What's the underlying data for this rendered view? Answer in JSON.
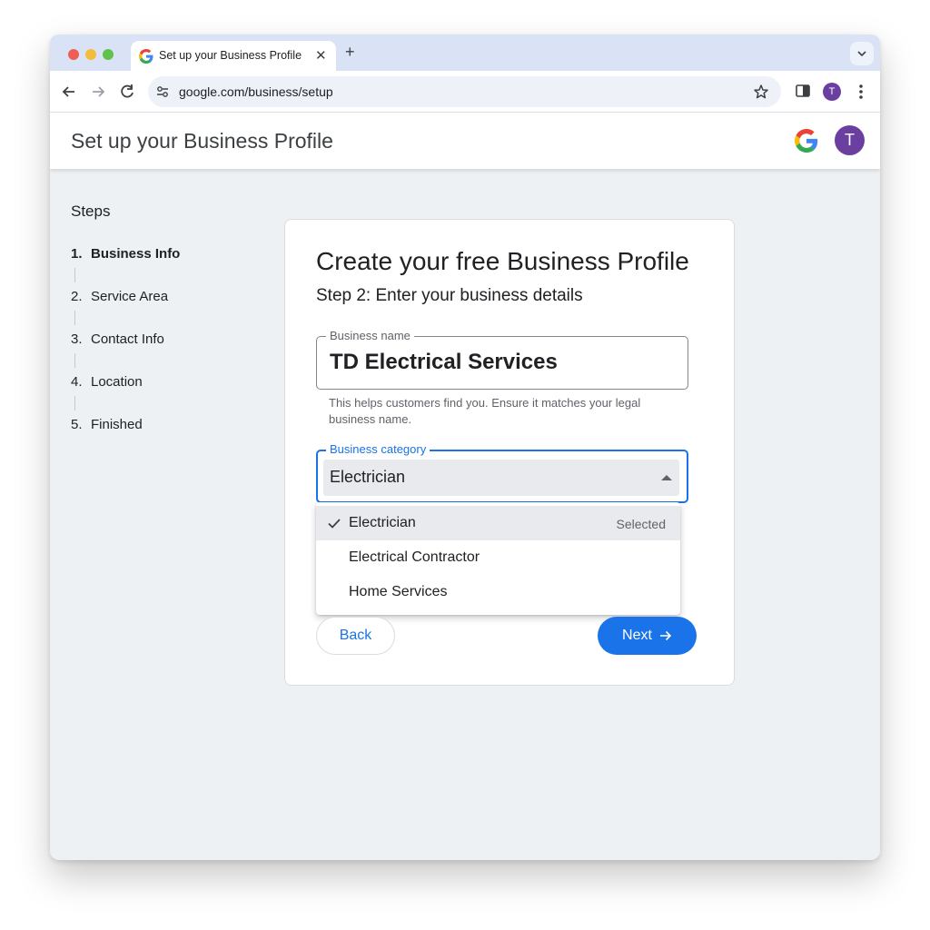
{
  "browser": {
    "tab_title": "Set up your Business Profile",
    "url": "google.com/business/setup",
    "profile_initial": "T"
  },
  "header": {
    "title": "Set up your Business Profile",
    "avatar_initial": "T"
  },
  "steps": {
    "title": "Steps",
    "items": [
      {
        "num": "1.",
        "label": "Business Info",
        "active": true
      },
      {
        "num": "2.",
        "label": "Service Area",
        "active": false
      },
      {
        "num": "3.",
        "label": "Contact Info",
        "active": false
      },
      {
        "num": "4.",
        "label": "Location",
        "active": false
      },
      {
        "num": "5.",
        "label": "Finished",
        "active": false
      }
    ]
  },
  "card": {
    "title": "Create your free Business Profile",
    "subtitle": "Step 2: Enter your business details",
    "business_name": {
      "label": "Business name",
      "value": "TD Electrical Services",
      "helper": "This helps customers find you. Ensure it matches your legal business name."
    },
    "business_category": {
      "label": "Business category",
      "value": "Electrician",
      "options": [
        {
          "label": "Electrician",
          "tag": "Selected",
          "selected": true
        },
        {
          "label": "Electrical Contractor",
          "tag": "",
          "selected": false
        },
        {
          "label": "Home Services",
          "tag": "",
          "selected": false
        }
      ]
    },
    "back_label": "Back",
    "next_label": "Next"
  },
  "colors": {
    "primary": "#1a73e8",
    "avatar": "#6b3fa0"
  }
}
